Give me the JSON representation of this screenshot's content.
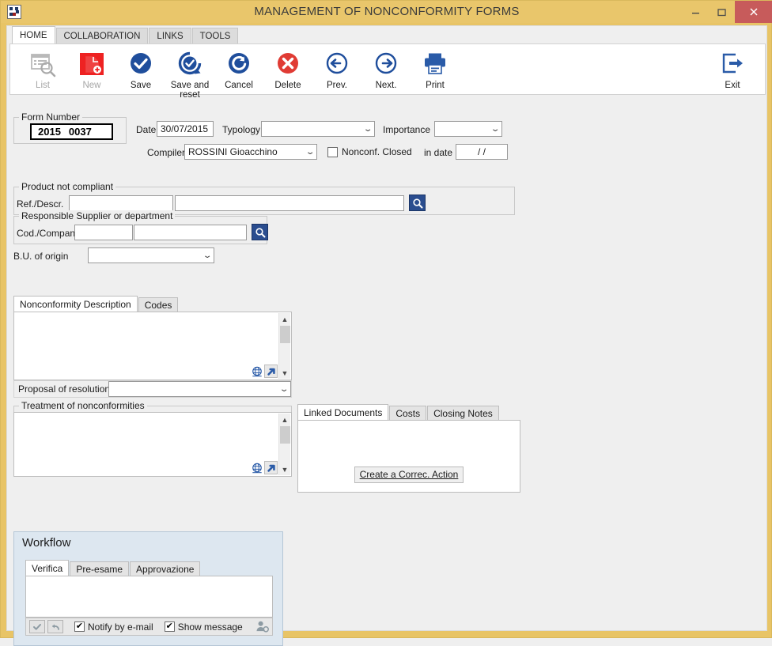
{
  "window": {
    "title": "MANAGEMENT OF NONCONFORMITY FORMS",
    "icon": "app-checkerboard-icon",
    "minimize": "–",
    "maximize": "❑",
    "close": "✕",
    "title_bar_color": "#e9c66b",
    "close_button_color": "#c75b5b"
  },
  "ribbon": {
    "tabs": [
      {
        "label": "HOME",
        "active": true
      },
      {
        "label": "COLLABORATION",
        "active": false
      },
      {
        "label": "LINKS",
        "active": false
      },
      {
        "label": "TOOLS",
        "active": false
      }
    ],
    "buttons": [
      {
        "label": "List",
        "icon": "list-search-icon",
        "disabled": true
      },
      {
        "label": "New",
        "icon": "new-document-icon",
        "disabled": true
      },
      {
        "label": "Save",
        "icon": "save-check-icon",
        "disabled": false
      },
      {
        "label": "Save and reset",
        "icon": "save-and-reset-icon",
        "disabled": false
      },
      {
        "label": "Cancel",
        "icon": "cancel-undo-icon",
        "disabled": false
      },
      {
        "label": "Delete",
        "icon": "delete-x-icon",
        "disabled": false
      },
      {
        "label": "Prev.",
        "icon": "arrow-left-icon",
        "disabled": false
      },
      {
        "label": "Next.",
        "icon": "arrow-right-icon",
        "disabled": false
      },
      {
        "label": "Print",
        "icon": "printer-icon",
        "disabled": false
      }
    ],
    "exit": {
      "label": "Exit",
      "icon": "exit-arrow-icon"
    }
  },
  "header_form": {
    "form_number_group": "Form Number",
    "form_year": "2015",
    "form_seq": "0037",
    "date_label": "Date",
    "date_value": "30/07/2015",
    "typology_label": "Typology",
    "typology_value": "",
    "importance_label": "Importance",
    "importance_value": "",
    "compiler_label": "Compiler",
    "compiler_value": "ROSSINI Gioacchino",
    "nonconf_closed_label": "Nonconf. Closed",
    "nonconf_closed_checked": false,
    "in_date_label": "in date",
    "in_date_value": "/     /"
  },
  "product_group": {
    "title": "Product not compliant",
    "ref_label": "Ref./Descr.",
    "ref_code_value": "",
    "ref_desc_value": "",
    "search_icon": "magnifier-icon"
  },
  "supplier_group": {
    "title": "Responsible Supplier or department",
    "cod_label": "Cod./Company",
    "cod_value": "",
    "company_value": "",
    "search_icon": "magnifier-icon"
  },
  "bu": {
    "label": "B.U. of origin",
    "value": ""
  },
  "description_panel": {
    "tabs": [
      {
        "label": "Nonconformity Description",
        "active": true
      },
      {
        "label": "Codes",
        "active": false
      }
    ],
    "text": "",
    "globe_icon": "globe-icon",
    "expand_icon": "expand-arrow-icon",
    "proposal_label": "Proposal of resolution",
    "proposal_value": ""
  },
  "treatment_group": {
    "title": "Treatment of nonconformities",
    "text": "",
    "globe_icon": "globe-icon",
    "expand_icon": "expand-arrow-icon"
  },
  "linked_panel": {
    "tabs": [
      {
        "label": "Linked Documents",
        "active": true
      },
      {
        "label": "Costs",
        "active": false
      },
      {
        "label": "Closing Notes",
        "active": false
      }
    ],
    "create_action_label": "Create a Correc. Action"
  },
  "workflow": {
    "title": "Workflow",
    "tabs": [
      {
        "label": "Verifica",
        "active": true
      },
      {
        "label": "Pre-esame",
        "active": false
      },
      {
        "label": "Approvazione",
        "active": false
      }
    ],
    "text": "",
    "approve_icon": "check-icon",
    "reject_icon": "undo-arrow-icon",
    "notify_label": "Notify by e-mail",
    "notify_checked": true,
    "show_message_label": "Show message",
    "show_message_checked": true,
    "user_icon": "user-settings-icon"
  }
}
